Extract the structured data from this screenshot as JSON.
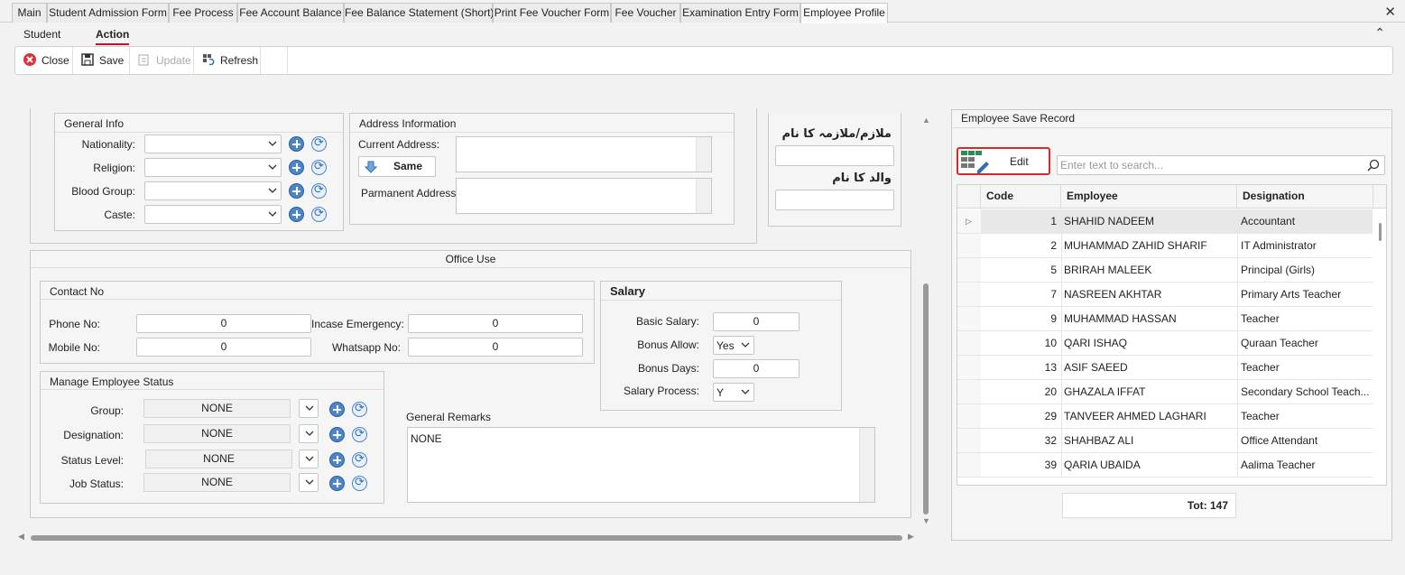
{
  "tabs": [
    "Main",
    "Student Admission Form",
    "Fee Process",
    "Fee Account Balance",
    "Fee Balance Statement (Short)",
    "Print Fee Voucher Form",
    "Fee Voucher",
    "Examination Entry Form",
    "Employee Profile"
  ],
  "active_tab": "Employee Profile",
  "ribbon_tabs": {
    "student": "Student",
    "action": "Action"
  },
  "toolbar": {
    "close": "Close",
    "save": "Save",
    "update": "Update",
    "refresh": "Refresh"
  },
  "general_info": {
    "title": "General Info",
    "nationality": "Nationality:",
    "religion": "Religion:",
    "blood_group": "Blood Group:",
    "caste": "Caste:"
  },
  "address": {
    "title": "Address Information",
    "current": "Current Address:",
    "same": "Same",
    "permanent": "Parmanent Address"
  },
  "urdu": {
    "employee_name": "ملازم/ملازمہ کا نام",
    "father_name": "والد کا نام"
  },
  "office_use": {
    "title": "Office Use"
  },
  "contact": {
    "title": "Contact No",
    "phone_label": "Phone No:",
    "phone": "0",
    "mobile_label": "Mobile No:",
    "mobile": "0",
    "emergency_label": "Incase Emergency:",
    "emergency": "0",
    "whatsapp_label": "Whatsapp No:",
    "whatsapp": "0"
  },
  "salary": {
    "title": "Salary",
    "basic_label": "Basic Salary:",
    "basic": "0",
    "bonus_allow_label": "Bonus Allow:",
    "bonus_allow": "Yes",
    "bonus_days_label": "Bonus Days:",
    "bonus_days": "0",
    "process_label": "Salary Process:",
    "process": "Y"
  },
  "status": {
    "title": "Manage Employee Status",
    "group_label": "Group:",
    "group": "NONE",
    "designation_label": "Designation:",
    "designation": "NONE",
    "status_level_label": "Status Level:",
    "status_level": "NONE",
    "job_status_label": "Job Status:",
    "job_status": "NONE"
  },
  "remarks": {
    "label": "General Remarks",
    "value": "NONE"
  },
  "grid": {
    "title": "Employee Save Record",
    "edit": "Edit",
    "search_placeholder": "Enter text to search...",
    "columns": [
      "Code",
      "Employee",
      "Designation"
    ],
    "rows": [
      [
        "1",
        "SHAHID NADEEM",
        "Accountant"
      ],
      [
        "2",
        "MUHAMMAD ZAHID SHARIF",
        "IT Administrator"
      ],
      [
        "5",
        "BRIRAH MALEEK",
        "Principal (Girls)"
      ],
      [
        "7",
        "NASREEN AKHTAR",
        "Primary Arts Teacher"
      ],
      [
        "9",
        "MUHAMMAD HASSAN",
        "Teacher"
      ],
      [
        "10",
        "QARI ISHAQ",
        "Quraan Teacher"
      ],
      [
        "13",
        "ASIF SAEED",
        "Teacher"
      ],
      [
        "20",
        "GHAZALA IFFAT",
        "Secondary School Teach..."
      ],
      [
        "29",
        "TANVEER AHMED LAGHARI",
        "Teacher"
      ],
      [
        "32",
        "SHAHBAZ ALI",
        "Office Attendant"
      ],
      [
        "39",
        "QARIA UBAIDA",
        "Aalima Teacher"
      ]
    ],
    "total": "Tot: 147"
  }
}
